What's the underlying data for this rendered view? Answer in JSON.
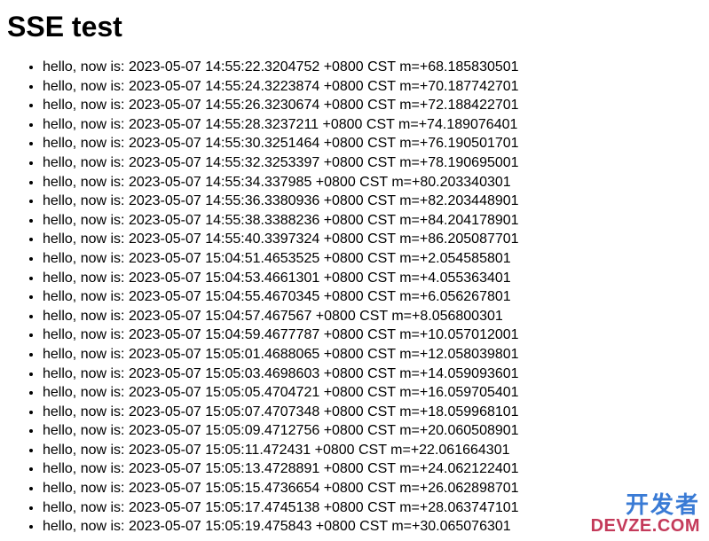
{
  "title": "SSE test",
  "items": [
    "hello, now is: 2023-05-07 14:55:22.3204752 +0800 CST m=+68.185830501",
    "hello, now is: 2023-05-07 14:55:24.3223874 +0800 CST m=+70.187742701",
    "hello, now is: 2023-05-07 14:55:26.3230674 +0800 CST m=+72.188422701",
    "hello, now is: 2023-05-07 14:55:28.3237211 +0800 CST m=+74.189076401",
    "hello, now is: 2023-05-07 14:55:30.3251464 +0800 CST m=+76.190501701",
    "hello, now is: 2023-05-07 14:55:32.3253397 +0800 CST m=+78.190695001",
    "hello, now is: 2023-05-07 14:55:34.337985 +0800 CST m=+80.203340301",
    "hello, now is: 2023-05-07 14:55:36.3380936 +0800 CST m=+82.203448901",
    "hello, now is: 2023-05-07 14:55:38.3388236 +0800 CST m=+84.204178901",
    "hello, now is: 2023-05-07 14:55:40.3397324 +0800 CST m=+86.205087701",
    "hello, now is: 2023-05-07 15:04:51.4653525 +0800 CST m=+2.054585801",
    "hello, now is: 2023-05-07 15:04:53.4661301 +0800 CST m=+4.055363401",
    "hello, now is: 2023-05-07 15:04:55.4670345 +0800 CST m=+6.056267801",
    "hello, now is: 2023-05-07 15:04:57.467567 +0800 CST m=+8.056800301",
    "hello, now is: 2023-05-07 15:04:59.4677787 +0800 CST m=+10.057012001",
    "hello, now is: 2023-05-07 15:05:01.4688065 +0800 CST m=+12.058039801",
    "hello, now is: 2023-05-07 15:05:03.4698603 +0800 CST m=+14.059093601",
    "hello, now is: 2023-05-07 15:05:05.4704721 +0800 CST m=+16.059705401",
    "hello, now is: 2023-05-07 15:05:07.4707348 +0800 CST m=+18.059968101",
    "hello, now is: 2023-05-07 15:05:09.4712756 +0800 CST m=+20.060508901",
    "hello, now is: 2023-05-07 15:05:11.472431 +0800 CST m=+22.061664301",
    "hello, now is: 2023-05-07 15:05:13.4728891 +0800 CST m=+24.062122401",
    "hello, now is: 2023-05-07 15:05:15.4736654 +0800 CST m=+26.062898701",
    "hello, now is: 2023-05-07 15:05:17.4745138 +0800 CST m=+28.063747101",
    "hello, now is: 2023-05-07 15:05:19.475843 +0800 CST m=+30.065076301"
  ],
  "watermark": {
    "line1": "开发者",
    "line2": "DEVZE.COM"
  }
}
